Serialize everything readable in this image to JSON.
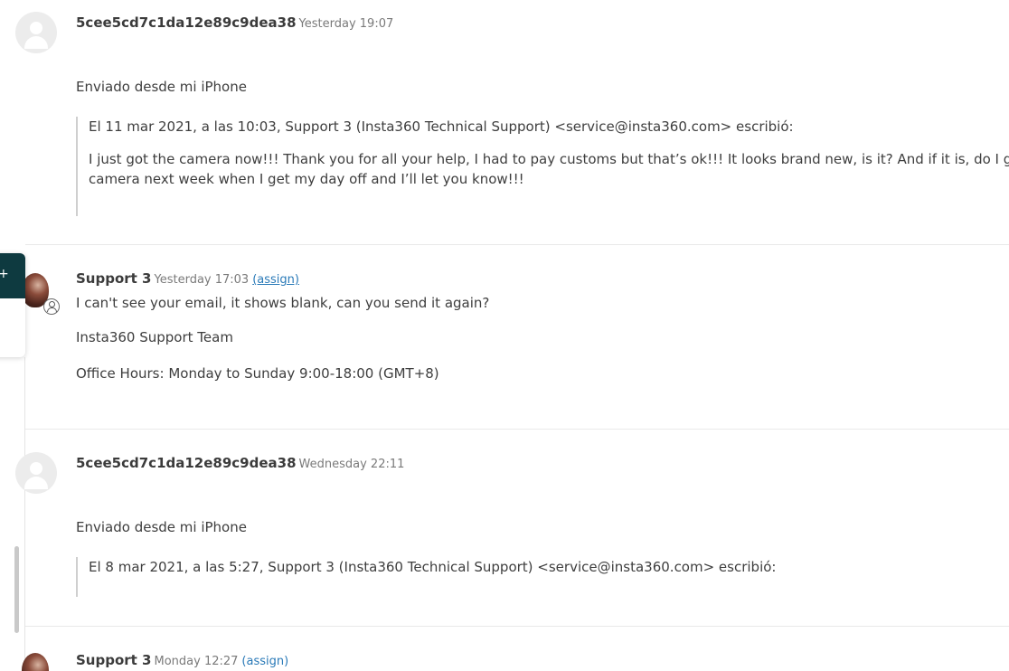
{
  "messages": [
    {
      "author": "5cee5cd7c1da12e89c9dea38",
      "time": "Yesterday 19:07",
      "body": "Enviado desde mi iPhone",
      "quote_header": "El 11 mar 2021, a las 10:03, Support 3 (Insta360 Technical Support) <service@insta360.com> escribió:",
      "quote_line1": "I just got the camera now!!! Thank you for all your help, I had to pay customs but that’s ok!!! It looks brand new, is it? And if it is, do I get new guara",
      "quote_line2": "camera next week when I get my day off and I’ll let you know!!!"
    },
    {
      "author": "Support 3",
      "time": "Yesterday 17:03",
      "assign": "(assign)",
      "line1": "I can't see your email, it shows blank, can you send it again?",
      "line2": "Insta360 Support Team",
      "line3": "Office Hours: Monday to Sunday 9:00-18:00 (GMT+8)"
    },
    {
      "author": "5cee5cd7c1da12e89c9dea38",
      "time": "Wednesday 22:11",
      "body": "Enviado desde mi iPhone",
      "quote_header": "El 8 mar 2021, a las 5:27, Support 3 (Insta360 Technical Support) <service@insta360.com> escribió:"
    },
    {
      "author": "Support 3",
      "time": "Monday 12:27",
      "assign": "(assign)"
    }
  ],
  "side_panel": {
    "icon": "plus-icon",
    "accent": "#0e3a40"
  },
  "colors": {
    "link": "#2a7ab8",
    "text": "#3e3e3e",
    "muted": "#7a7a7a"
  }
}
